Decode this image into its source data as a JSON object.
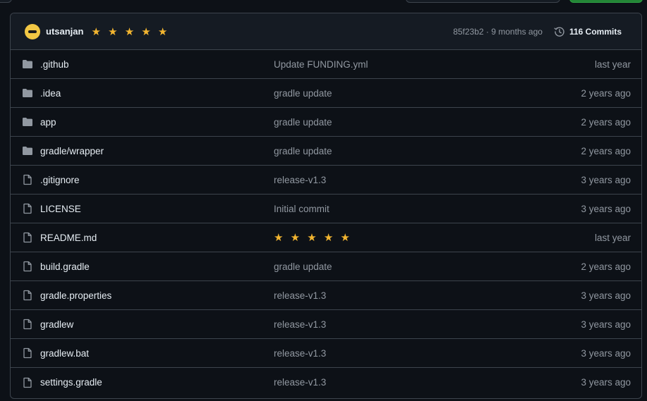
{
  "header": {
    "author": "utsanjan",
    "message": "★ ★ ★ ★ ★",
    "meta": "85f23b2 · 9 months ago",
    "commits": "116 Commits",
    "icons": {
      "avatar": "avatar",
      "history": "clock-history-icon"
    }
  },
  "colors": {
    "background": "#0d1117",
    "border": "#3d444d",
    "muted": "#9198a1",
    "stars": "#f2b530",
    "green": "#238636"
  },
  "files": [
    {
      "type": "folder",
      "name": ".github",
      "message": "Update FUNDING.yml",
      "time": "last year"
    },
    {
      "type": "folder",
      "name": ".idea",
      "message": "gradle update",
      "time": "2 years ago"
    },
    {
      "type": "folder",
      "name": "app",
      "message": "gradle update",
      "time": "2 years ago"
    },
    {
      "type": "folder",
      "name": "gradle/wrapper",
      "message": "gradle update",
      "time": "2 years ago"
    },
    {
      "type": "file",
      "name": ".gitignore",
      "message": "release-v1.3",
      "time": "3 years ago"
    },
    {
      "type": "file",
      "name": "LICENSE",
      "message": "Initial commit",
      "time": "3 years ago"
    },
    {
      "type": "file",
      "name": "README.md",
      "message": "★ ★ ★ ★ ★",
      "time": "last year"
    },
    {
      "type": "file",
      "name": "build.gradle",
      "message": "gradle update",
      "time": "2 years ago"
    },
    {
      "type": "file",
      "name": "gradle.properties",
      "message": "release-v1.3",
      "time": "3 years ago"
    },
    {
      "type": "file",
      "name": "gradlew",
      "message": "release-v1.3",
      "time": "3 years ago"
    },
    {
      "type": "file",
      "name": "gradlew.bat",
      "message": "release-v1.3",
      "time": "3 years ago"
    },
    {
      "type": "file",
      "name": "settings.gradle",
      "message": "release-v1.3",
      "time": "3 years ago"
    }
  ]
}
